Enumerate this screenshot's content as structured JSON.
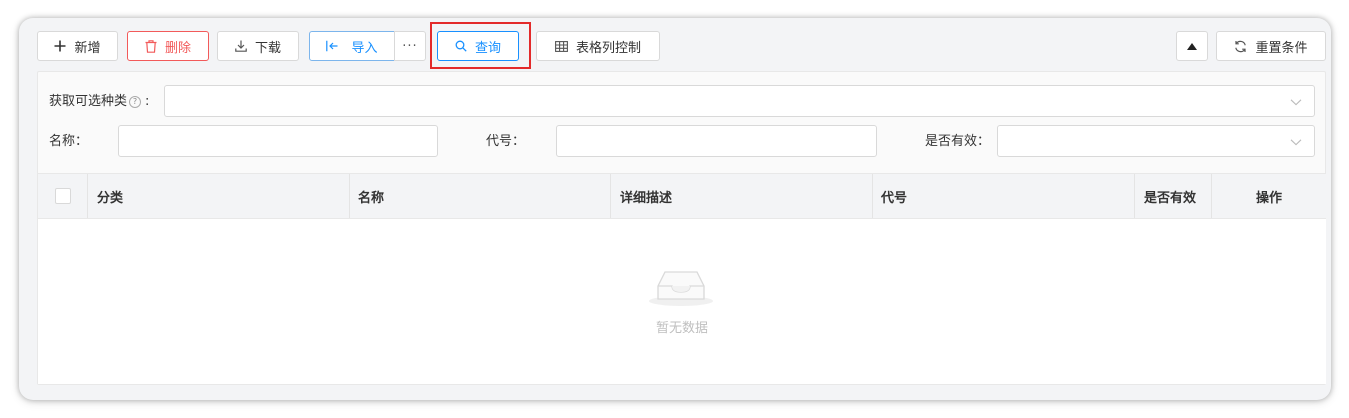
{
  "toolbar": {
    "add_label": "新增",
    "delete_label": "删除",
    "download_label": "下载",
    "import_label": "导入",
    "more_label": "···",
    "query_label": "查询",
    "columns_label": "表格列控制",
    "reset_label": "重置条件"
  },
  "filters": {
    "category_label": "获取可选种类",
    "category_colon": ":",
    "name_label": "名称：",
    "code_label": "代号：",
    "valid_label": "是否有效："
  },
  "table": {
    "columns": [
      "分类",
      "名称",
      "详细描述",
      "代号",
      "是否有效",
      "操作"
    ],
    "empty_text": "暂无数据"
  },
  "colors": {
    "primary": "#1890ff",
    "danger": "#f25a5a",
    "highlight": "#e32a2a"
  },
  "icons": {
    "add": "plus-icon",
    "delete": "trash-icon",
    "download": "download-icon",
    "import": "import-icon",
    "query": "search-icon",
    "columns": "table-icon",
    "collapse": "caret-up-icon",
    "reset": "refresh-icon",
    "empty": "inbox-icon"
  }
}
